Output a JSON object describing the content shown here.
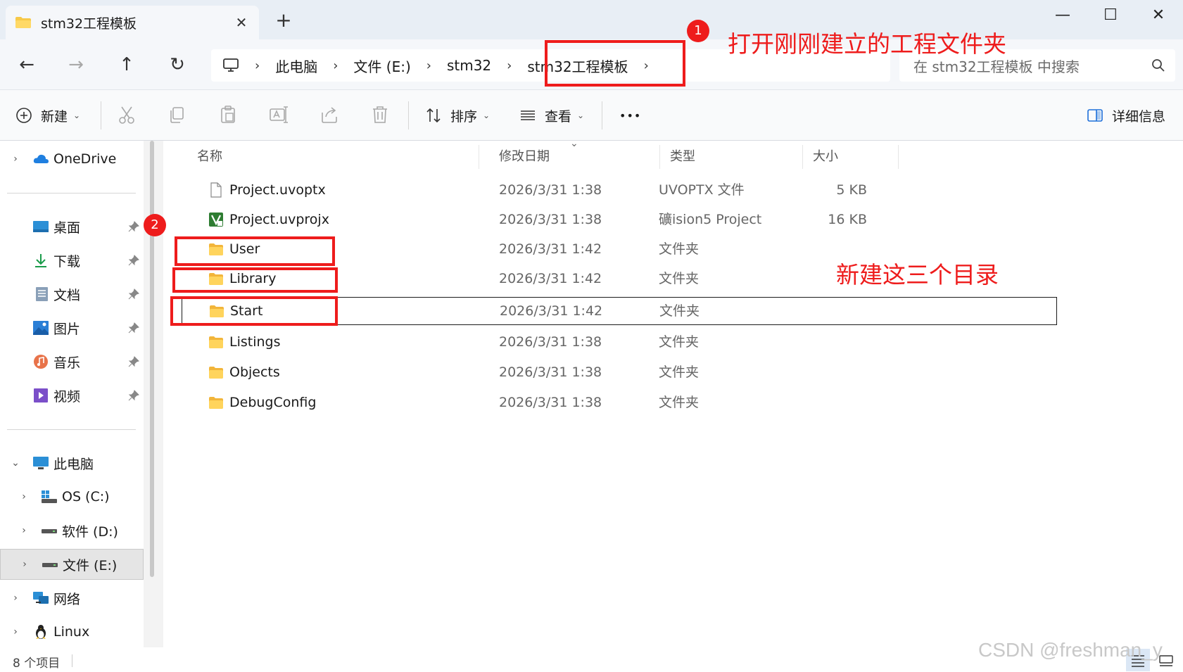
{
  "window": {
    "tab_title": "stm32工程模板",
    "tab_close": "✕",
    "new_tab": "+",
    "minimize": "—",
    "maximize": "☐",
    "close": "✕"
  },
  "nav": {
    "back": "←",
    "forward": "→",
    "up": "↑",
    "refresh": "↻",
    "breadcrumbs": [
      "此电脑",
      "文件 (E:)",
      "stm32",
      "stm32工程模板"
    ],
    "separator": "›",
    "search_placeholder": "在 stm32工程模板 中搜索"
  },
  "toolbar": {
    "new_label": "新建",
    "sort_label": "排序",
    "view_label": "查看",
    "more_label": "•••",
    "details_label": "详细信息",
    "caret": "⌄"
  },
  "sidebar": {
    "chevron_right": "›",
    "chevron_down": "⌄",
    "onedrive": "OneDrive",
    "quick_access": [
      {
        "label": "桌面"
      },
      {
        "label": "下载"
      },
      {
        "label": "文档"
      },
      {
        "label": "图片"
      },
      {
        "label": "音乐"
      },
      {
        "label": "视频"
      }
    ],
    "this_pc": "此电脑",
    "drives": [
      {
        "label": "OS (C:)"
      },
      {
        "label": "软件 (D:)"
      },
      {
        "label": "文件 (E:)"
      }
    ],
    "network": "网络",
    "linux": "Linux"
  },
  "columns": {
    "name": "名称",
    "modified": "修改日期",
    "type": "类型",
    "size": "大小"
  },
  "files": [
    {
      "name": "Project.uvoptx",
      "modified": "2026/3/31 1:38",
      "type": "UVOPTX 文件",
      "size": "5 KB"
    },
    {
      "name": "Project.uvprojx",
      "modified": "2026/3/31 1:38",
      "type": "礦ision5 Project",
      "size": "16 KB"
    },
    {
      "name": "User",
      "modified": "2026/3/31 1:42",
      "type": "文件夹",
      "size": ""
    },
    {
      "name": "Library",
      "modified": "2026/3/31 1:42",
      "type": "文件夹",
      "size": ""
    },
    {
      "name": "Start",
      "modified": "2026/3/31 1:42",
      "type": "文件夹",
      "size": ""
    },
    {
      "name": "Listings",
      "modified": "2026/3/31 1:38",
      "type": "文件夹",
      "size": ""
    },
    {
      "name": "Objects",
      "modified": "2026/3/31 1:38",
      "type": "文件夹",
      "size": ""
    },
    {
      "name": "DebugConfig",
      "modified": "2026/3/31 1:38",
      "type": "文件夹",
      "size": ""
    }
  ],
  "status": {
    "count": "8 个项目"
  },
  "annotations": {
    "badge1": "1",
    "badge2": "2",
    "text1": "打开刚刚建立的工程文件夹",
    "text2": "新建这三个目录",
    "watermark": "CSDN @freshman_y"
  },
  "colors": {
    "annotation_red": "#ee1c1c",
    "folder_yellow": "#f7c948"
  }
}
